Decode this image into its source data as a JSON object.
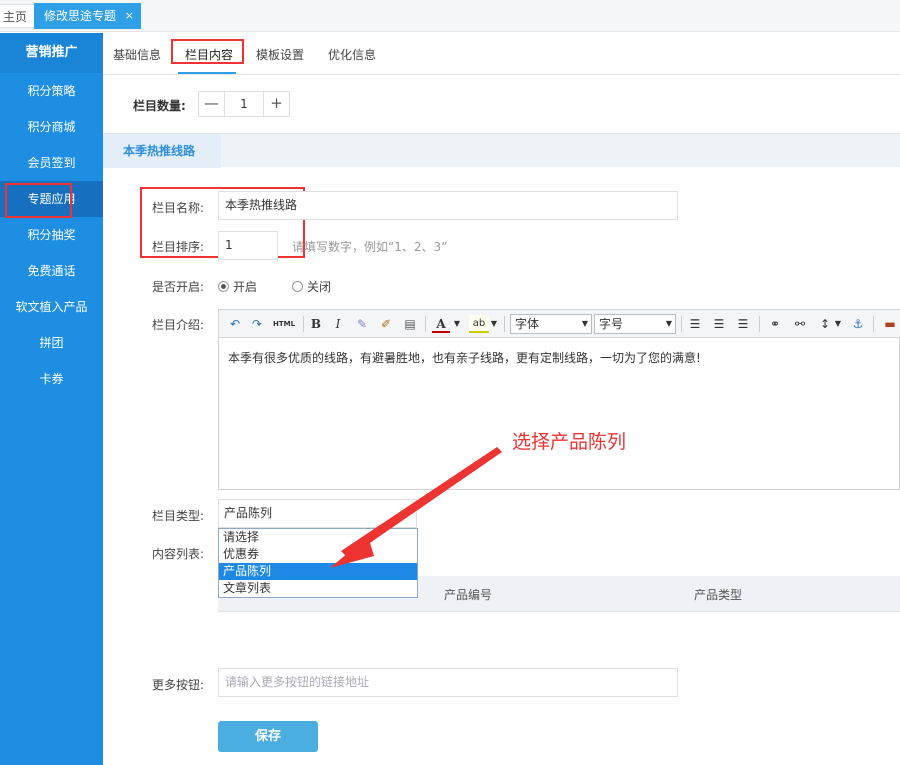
{
  "top_tabs": {
    "home": "主页",
    "active": "修改思途专题",
    "close": "×"
  },
  "sidebar": {
    "header": "营销推广",
    "items": [
      {
        "label": "积分策略"
      },
      {
        "label": "积分商城"
      },
      {
        "label": "会员签到"
      },
      {
        "label": "专题应用",
        "active": true
      },
      {
        "label": "积分抽奖"
      },
      {
        "label": "免费通话"
      },
      {
        "label": "软文植入产品"
      },
      {
        "label": "拼团"
      },
      {
        "label": "卡券"
      }
    ]
  },
  "content_tabs": [
    {
      "label": "基础信息"
    },
    {
      "label": "栏目内容",
      "active": true
    },
    {
      "label": "模板设置"
    },
    {
      "label": "优化信息"
    }
  ],
  "column_count": {
    "label": "栏目数量:",
    "minus": "—",
    "value": "1",
    "plus": "+"
  },
  "section_tab": "本季热推线路",
  "form": {
    "name_label": "栏目名称:",
    "name_value": "本季热推线路",
    "sort_label": "栏目排序:",
    "sort_value": "1",
    "sort_hint": "请填写数字，例如“1、2、3”",
    "enabled_label": "是否开启:",
    "enabled_on": "开启",
    "enabled_off": "关闭",
    "intro_label": "栏目介绍:",
    "intro_text": "本季有很多优质的线路，有避暑胜地，也有亲子线路，更有定制线路，一切为了您的满意!",
    "type_label": "栏目类型:",
    "type_value": "产品陈列",
    "content_list_label": "内容列表:",
    "more_button_label": "更多按钮:",
    "more_button_placeholder": "请输入更多按钮的链接地址",
    "save": "保存"
  },
  "editor_toolbar": {
    "html": "HTML",
    "bold": "B",
    "italic": "I",
    "font_color": "A",
    "font_family": "字体",
    "font_size": "字号"
  },
  "type_options": [
    "请选择",
    "优惠券",
    "产品陈列",
    "文章列表"
  ],
  "table_columns": [
    "产品编号",
    "产品类型"
  ],
  "annotation": "选择产品陈列",
  "colors": {
    "accent": "#2f9fe8",
    "sidebar": "#1e8ee2",
    "highlight": "#ee3333"
  }
}
